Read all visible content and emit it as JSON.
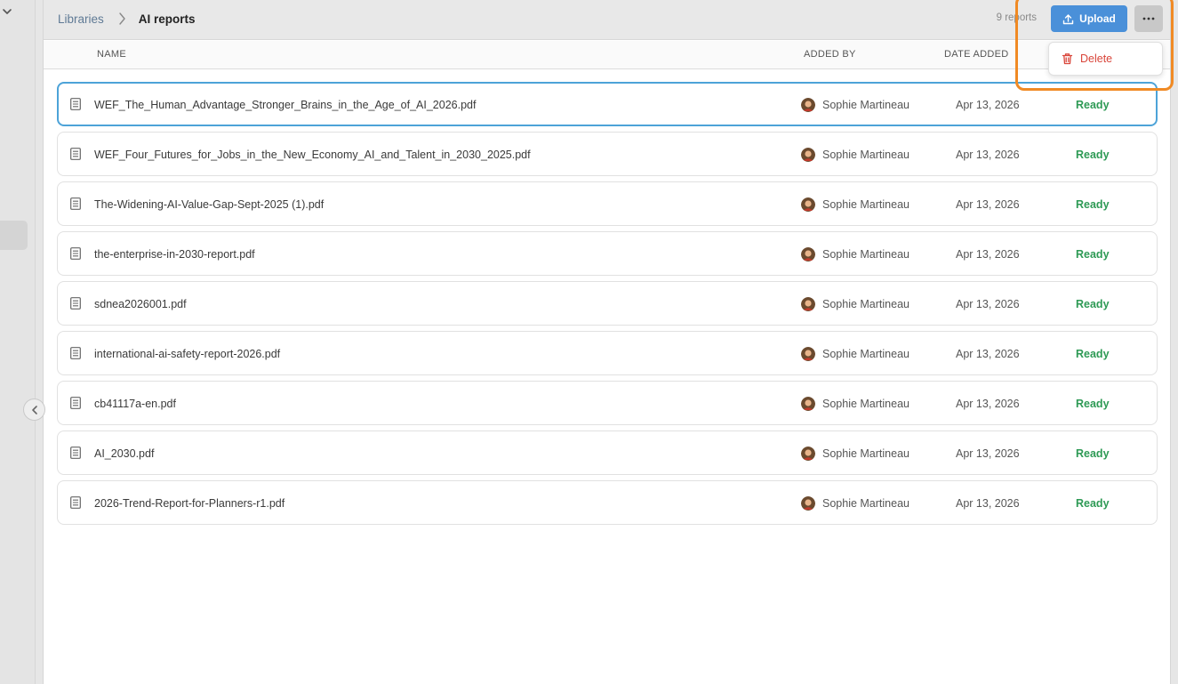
{
  "breadcrumb": {
    "parent": "Libraries",
    "current": "AI reports"
  },
  "toolbar": {
    "count": "9 reports",
    "upload_label": "Upload",
    "more_icon": "ellipsis-icon"
  },
  "menu": {
    "items": [
      {
        "label": "Delete",
        "icon": "trash-icon",
        "color": "#d9453a"
      }
    ]
  },
  "table": {
    "headers": {
      "name": "NAME",
      "added_by": "ADDED BY",
      "date_added": "DATE ADDED"
    },
    "rows": [
      {
        "name": "WEF_The_Human_Advantage_Stronger_Brains_in_the_Age_of_AI_2026.pdf",
        "added_by": "Sophie Martineau",
        "date": "Apr 13, 2026",
        "status": "Ready"
      },
      {
        "name": "WEF_Four_Futures_for_Jobs_in_the_New_Economy_AI_and_Talent_in_2030_2025.pdf",
        "added_by": "Sophie Martineau",
        "date": "Apr 13, 2026",
        "status": "Ready"
      },
      {
        "name": "The-Widening-AI-Value-Gap-Sept-2025 (1).pdf",
        "added_by": "Sophie Martineau",
        "date": "Apr 13, 2026",
        "status": "Ready"
      },
      {
        "name": "the-enterprise-in-2030-report.pdf",
        "added_by": "Sophie Martineau",
        "date": "Apr 13, 2026",
        "status": "Ready"
      },
      {
        "name": "sdnea2026001.pdf",
        "added_by": "Sophie Martineau",
        "date": "Apr 13, 2026",
        "status": "Ready"
      },
      {
        "name": "international-ai-safety-report-2026.pdf",
        "added_by": "Sophie Martineau",
        "date": "Apr 13, 2026",
        "status": "Ready"
      },
      {
        "name": "cb41117a-en.pdf",
        "added_by": "Sophie Martineau",
        "date": "Apr 13, 2026",
        "status": "Ready"
      },
      {
        "name": "AI_2030.pdf",
        "added_by": "Sophie Martineau",
        "date": "Apr 13, 2026",
        "status": "Ready"
      },
      {
        "name": "2026-Trend-Report-for-Planners-r1.pdf",
        "added_by": "Sophie Martineau",
        "date": "Apr 13, 2026",
        "status": "Ready"
      }
    ]
  },
  "colors": {
    "accent": "#4a90d9",
    "ready": "#2e9a55",
    "danger": "#d9453a",
    "highlight": "#f08a24",
    "selected_border": "#4da3d8"
  }
}
